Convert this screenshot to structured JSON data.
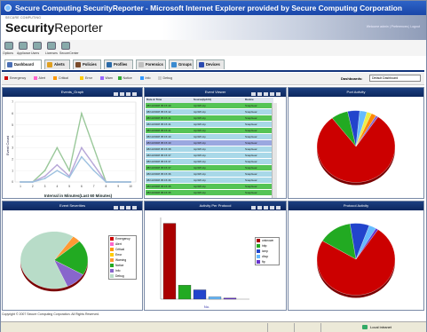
{
  "window": {
    "title": "Secure Computing SecurityReporter - Microsoft Internet Explorer provided by Secure Computing Corporation"
  },
  "brand": {
    "company": "SECURE COMPUTING",
    "product": "Security",
    "product_rest": "Reporter",
    "header_links": "Welcome admin | Preferences | Logout"
  },
  "toolbar": {
    "items": [
      {
        "label": "Options",
        "icon": "options-icon"
      },
      {
        "label": "Appliance",
        "icon": "appliance-icon"
      },
      {
        "label": "Users",
        "icon": "users-icon"
      },
      {
        "label": "Licenses",
        "icon": "licenses-icon"
      },
      {
        "label": "SecureCenter",
        "icon": "securecenter-icon"
      }
    ]
  },
  "nav": {
    "tabs": [
      {
        "label": "Dashboard",
        "color": "#4a6fb5",
        "active": true
      },
      {
        "label": "Alerts",
        "color": "#e0a020",
        "active": false
      },
      {
        "label": "Policies",
        "color": "#7a4a2a",
        "active": false
      },
      {
        "label": "Profiles",
        "color": "#2a6aa8",
        "active": false
      },
      {
        "label": "Forensics",
        "color": "#c0c0c0",
        "active": false
      },
      {
        "label": "Groups",
        "color": "#3a8ad0",
        "active": false
      },
      {
        "label": "Devices",
        "color": "#2a4ab0",
        "active": false
      }
    ]
  },
  "filters": {
    "severities": [
      {
        "label": "Emergency",
        "color": "#cc0000"
      },
      {
        "label": "Alert",
        "color": "#ff66cc"
      },
      {
        "label": "Critical",
        "color": "#ff9900"
      },
      {
        "label": "Error",
        "color": "#ffcc00"
      },
      {
        "label": "Warn",
        "color": "#9966ff"
      },
      {
        "label": "Notice",
        "color": "#33aa33"
      },
      {
        "label": "Info",
        "color": "#3399ff"
      },
      {
        "label": "Debug",
        "color": "#cccccc"
      }
    ],
    "dashboards_label": "Dashboards:",
    "dashboards_value": "Default Dashboard"
  },
  "panels": {
    "events_graph": {
      "title": "Events_Graph",
      "ylabel": "Event Count",
      "xlabel": "Interval in Minutes(Last 60 Minutes)"
    },
    "event_viewer": {
      "title": "Event Viewer",
      "columns": [
        "Date & Time",
        "Source(Ip/Url)",
        "Device"
      ],
      "rows": [
        {
          "date": "08/13/2008 05:15:40",
          "source": "tcp/0/0.tcp",
          "device": "SnapGear",
          "color": "#55c455"
        },
        {
          "date": "08/13/2008 05:15:42",
          "source": "tcp/0/0.tcp",
          "device": "SnapGear",
          "color": "#a8d8e8"
        },
        {
          "date": "08/13/2008 05:15:41",
          "source": "tcp/0/0.tcp",
          "device": "SnapGear",
          "color": "#55c455"
        },
        {
          "date": "08/13/2008 05:15:41",
          "source": "tcp/0/0.tcp",
          "device": "SnapGear",
          "color": "#a8d8e8"
        },
        {
          "date": "08/13/2008 05:15:41",
          "source": "tcp/0/0.tcp",
          "device": "SnapGear",
          "color": "#55c455"
        },
        {
          "date": "08/13/2008 05:15:40",
          "source": "tcp/0/0.tcp",
          "device": "SnapGear",
          "color": "#a8d8e8"
        },
        {
          "date": "08/13/2008 05:15:40",
          "source": "tcp/0/0.tcp",
          "device": "SnapGear",
          "color": "#9aa8e0"
        },
        {
          "date": "08/13/2008 05:15:38",
          "source": "tcp/0/0.tcp",
          "device": "SnapGear",
          "color": "#a8d8e8"
        },
        {
          "date": "08/13/2008 05:15:37",
          "source": "tcp/0/0.tcp",
          "device": "SnapGear",
          "color": "#a8d8e8"
        },
        {
          "date": "08/13/2008 05:15:37",
          "source": "tcp/0/0.tcp",
          "device": "SnapGear",
          "color": "#a8d8e8"
        },
        {
          "date": "08/13/2008 05:15:37",
          "source": "tcp/0/0.tcp",
          "device": "SnapGear",
          "color": "#55c455"
        },
        {
          "date": "08/13/2008 05:15:36",
          "source": "tcp/0/0.tcp",
          "device": "SnapGear",
          "color": "#a8d8e8"
        },
        {
          "date": "08/13/2008 05:15:36",
          "source": "tcp/0/0.tcp",
          "device": "SnapGear",
          "color": "#a8d8e8"
        },
        {
          "date": "08/13/2008 05:15:35",
          "source": "tcp/0/0.tcp",
          "device": "SnapGear",
          "color": "#55c455"
        },
        {
          "date": "08/13/2008 05:15:35",
          "source": "tcp/0/0.tcp",
          "device": "SnapGear",
          "color": "#55c455"
        }
      ]
    },
    "port_activity": {
      "title": "Port Activity"
    },
    "event_severities": {
      "title": "Event Severities"
    },
    "activity_per_protocol": {
      "title": "Activity Per Protocol",
      "xlabel": "No."
    },
    "protocol_activity": {
      "title": "Protocol Activity"
    }
  },
  "footer": {
    "copyright": "Copyright © 2007 Secure Computing Corporation. All Rights Reserved.",
    "ie_zone": "Local intranet"
  },
  "chart_data": [
    {
      "type": "line",
      "x": [
        1,
        2,
        3,
        4,
        5,
        6,
        7,
        8,
        9,
        10
      ],
      "series": [
        {
          "name": "",
          "color": "#9ac89a",
          "values": [
            0,
            0,
            1,
            3,
            1,
            6,
            3,
            0,
            0,
            0
          ]
        },
        {
          "name": "",
          "color": "#b7a7d8",
          "values": [
            0,
            0,
            0.5,
            1.5,
            0.5,
            3,
            1.5,
            0,
            0,
            0
          ]
        },
        {
          "name": "",
          "color": "#9dc1e0",
          "values": [
            0,
            0,
            0.3,
            1,
            0.4,
            2.2,
            1,
            0,
            0,
            0
          ]
        }
      ],
      "xlabel": "Interval in Minutes(Last 60 Minutes)",
      "ylabel": "Event Count",
      "ylim": [
        0,
        7
      ]
    },
    {
      "type": "pie",
      "title": "Port Activity",
      "values": [
        80,
        7,
        5,
        3,
        2,
        2,
        1
      ],
      "colors": [
        "#cc0000",
        "#22aa22",
        "#2244cc",
        "#66bbff",
        "#eeee44",
        "#ff8800",
        "#8866cc"
      ]
    },
    {
      "type": "pie",
      "title": "Event Severities",
      "categories": [
        "Emergency",
        "Alert",
        "Critical",
        "Error",
        "Warning",
        "Notice",
        "Info",
        "Debug"
      ],
      "values": [
        0,
        0,
        0,
        0,
        4,
        20,
        10,
        66
      ],
      "colors": [
        "#cc0000",
        "#ff66cc",
        "#ff9900",
        "#ffcc00",
        "#ff9933",
        "#22aa22",
        "#8866cc",
        "#b8dcc8"
      ]
    },
    {
      "type": "bar",
      "title": "Activity Per Protocol",
      "categories": [
        "unknown",
        "http",
        "icmp",
        "dhcp",
        "ftp"
      ],
      "values": [
        65,
        12,
        8,
        2,
        1
      ],
      "colors": [
        "#aa0000",
        "#22aa22",
        "#2244cc",
        "#66bbff",
        "#6633cc"
      ],
      "ylim": [
        0,
        70
      ]
    },
    {
      "type": "pie",
      "title": "Protocol Activity",
      "values": [
        74,
        14,
        8,
        3,
        1
      ],
      "colors": [
        "#cc0000",
        "#22aa22",
        "#2244cc",
        "#66bbff",
        "#6633cc"
      ]
    }
  ]
}
